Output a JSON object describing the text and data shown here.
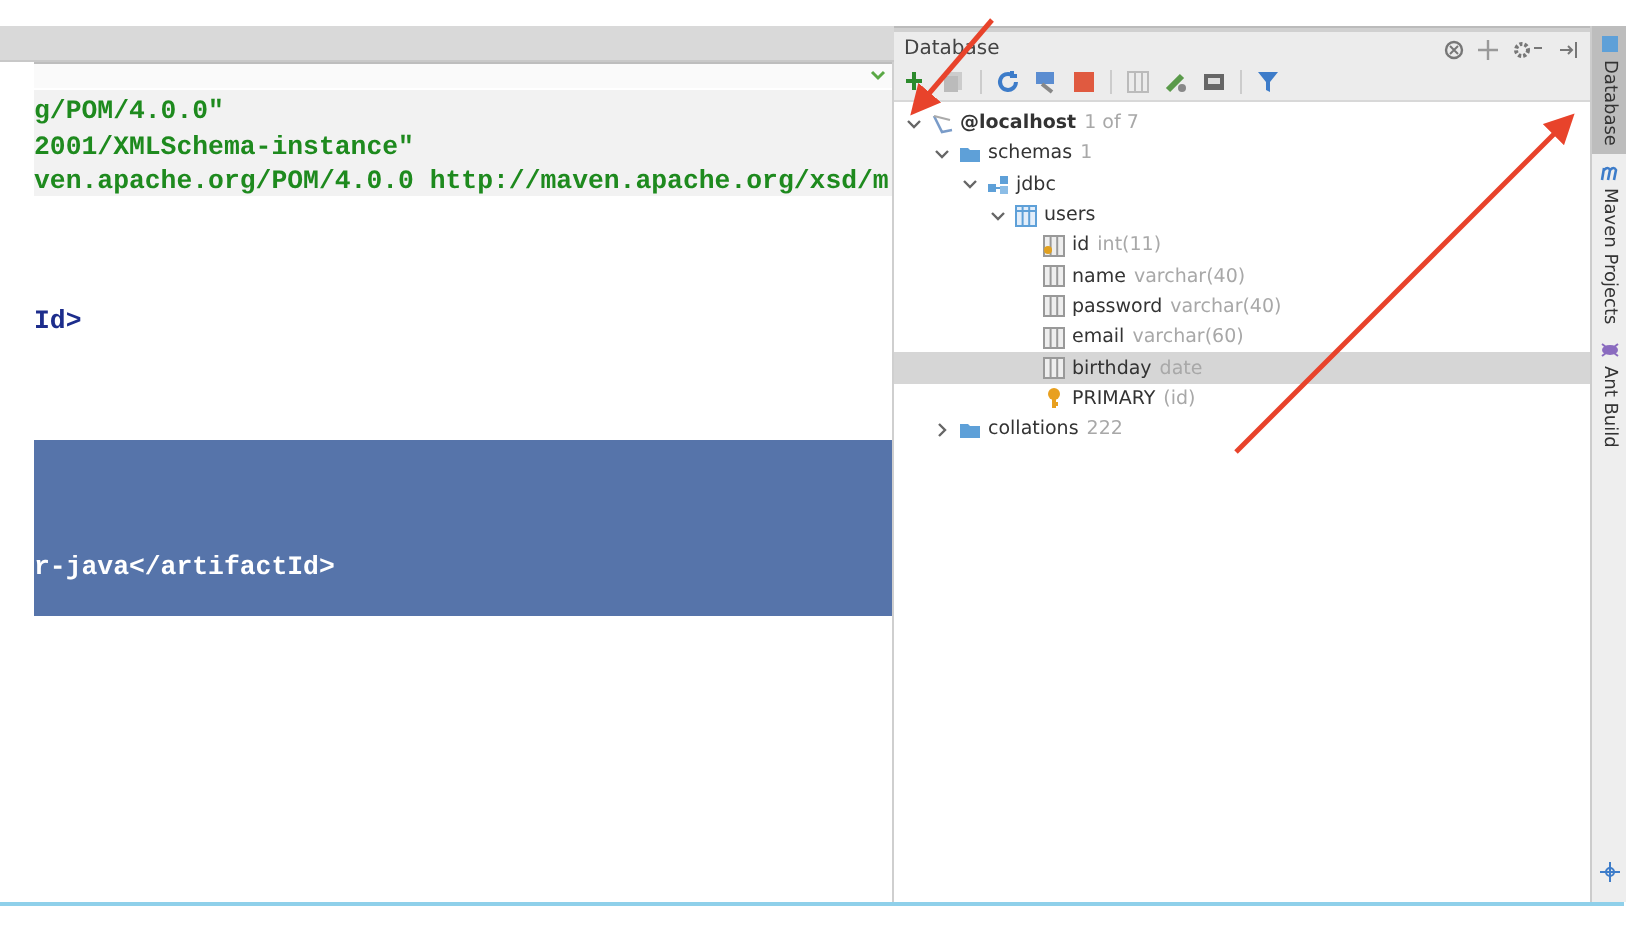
{
  "editor": {
    "lines": [
      {
        "kind": "string",
        "text": "g/POM/4.0.0\"",
        "selected": false
      },
      {
        "kind": "string",
        "text": "2001/XMLSchema-instance\"",
        "selected": false
      },
      {
        "kind": "string",
        "text": "ven.apache.org/POM/4.0.0 http://maven.apache.org/xsd/m",
        "selected": false
      },
      {
        "kind": "blank",
        "selected": false
      },
      {
        "kind": "blank",
        "selected": false
      },
      {
        "kind": "blank",
        "selected": false
      },
      {
        "kind": "tag",
        "text": "Id>",
        "selected": false
      },
      {
        "kind": "blank",
        "selected": false
      },
      {
        "kind": "blank",
        "selected": false
      },
      {
        "kind": "blank",
        "selected": false
      },
      {
        "kind": "blank",
        "selected": true
      },
      {
        "kind": "blank",
        "selected": true
      },
      {
        "kind": "blank",
        "selected": true
      },
      {
        "kind": "tag",
        "text": "r-java</artifactId>",
        "selected": true
      },
      {
        "kind": "blank",
        "selected": true
      }
    ]
  },
  "database_panel": {
    "title": "Database",
    "tree": [
      {
        "kind": "host",
        "name": "@localhost",
        "detail": "1 of 7",
        "expanded": true,
        "selected": false,
        "children": [
          {
            "kind": "folder",
            "name": "schemas",
            "detail": "1",
            "expanded": true,
            "selected": false,
            "children": [
              {
                "kind": "schema",
                "name": "jdbc",
                "expanded": true,
                "selected": false,
                "children": [
                  {
                    "kind": "table",
                    "name": "users",
                    "expanded": true,
                    "selected": false,
                    "children": [
                      {
                        "kind": "key-column",
                        "name": "id",
                        "detail": "int(11)",
                        "selected": false
                      },
                      {
                        "kind": "column",
                        "name": "name",
                        "detail": "varchar(40)",
                        "selected": false
                      },
                      {
                        "kind": "column",
                        "name": "password",
                        "detail": "varchar(40)",
                        "selected": false
                      },
                      {
                        "kind": "column",
                        "name": "email",
                        "detail": "varchar(60)",
                        "selected": false
                      },
                      {
                        "kind": "column",
                        "name": "birthday",
                        "detail": "date",
                        "selected": true
                      },
                      {
                        "kind": "key",
                        "name": "PRIMARY",
                        "detail": "(id)",
                        "selected": false
                      }
                    ]
                  }
                ]
              }
            ]
          },
          {
            "kind": "folder",
            "name": "collations",
            "detail": "222",
            "expanded": false,
            "selected": false
          }
        ]
      }
    ]
  },
  "side_tabs": [
    {
      "kind": "database",
      "label": "Database",
      "selected": true
    },
    {
      "kind": "maven",
      "label": "Maven Projects",
      "selected": false
    },
    {
      "kind": "ant",
      "label": "Ant Build",
      "selected": false
    }
  ]
}
